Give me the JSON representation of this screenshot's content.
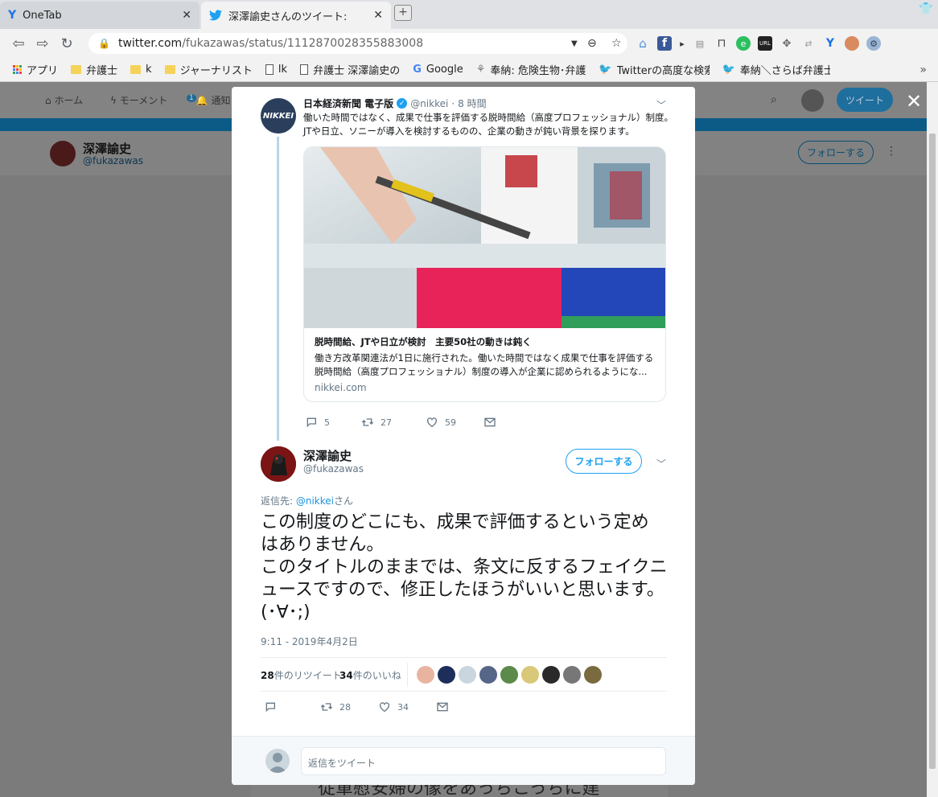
{
  "browser": {
    "tabs": [
      {
        "title": "OneTab",
        "active": false
      },
      {
        "title": "深澤諭史さんのツイート: \"この制",
        "active": true
      }
    ],
    "url_host": "twitter.com",
    "url_path": "/fukazawas/status/1112870028355883008",
    "bookmarks": [
      {
        "label": "アプリ",
        "type": "apps"
      },
      {
        "label": "弁護士",
        "type": "folder"
      },
      {
        "label": "k",
        "type": "folder"
      },
      {
        "label": "ジャーナリスト",
        "type": "folder"
      },
      {
        "label": "lk",
        "type": "doc"
      },
      {
        "label": "弁護士 深澤諭史の",
        "type": "doc"
      },
      {
        "label": "Google",
        "type": "google"
      },
      {
        "label": "奉納: 危険生物･弁護",
        "type": "other"
      },
      {
        "label": "Twitterの高度な検索",
        "type": "twitter"
      },
      {
        "label": "奉納＼さらば弁護士",
        "type": "twitter"
      }
    ],
    "extension_icons": [
      "home-icon",
      "facebook-icon",
      "arrow-icon",
      "box-icon",
      "bookmark-icon",
      "evernote-icon",
      "url-icon",
      "move-icon",
      "link-icon",
      "y-icon",
      "avatar-icon",
      "gear-icon"
    ]
  },
  "background": {
    "nav": {
      "home": "ホーム",
      "moments": "モーメント",
      "notifications": "通知",
      "notif_count": "1"
    },
    "tweet_button": "ツイート",
    "profile_name": "深澤諭史",
    "profile_handle": "@fukazawas",
    "follow_label": "フォローする",
    "bottom_text": "従軍慰安婦の像をあっちこっちに建"
  },
  "quoted_tweet": {
    "name": "日本経済新聞 電子版",
    "handle": "@nikkei",
    "dot": "·",
    "time": "8 時間",
    "avatar_text": "NIKKEI",
    "text": "働いた時間ではなく、成果で仕事を評価する脱時間給（高度プロフェッショナル）制度。JTや日立、ソニーが導入を検討するものの、企業の動きが鈍い背景を探ります。",
    "card": {
      "title": "脱時間給、JTや日立が検討　主要50社の動きは鈍く",
      "description": "働き方改革関連法が1日に施行された。働いた時間ではなく成果で仕事を評価する脱時間給（高度プロフェッショナル）制度の導入が企業に認められるようにな...",
      "domain": "nikkei.com"
    },
    "replies": "5",
    "retweets": "27",
    "likes": "59"
  },
  "main_tweet": {
    "name": "深澤諭史",
    "handle": "@fukazawas",
    "follow_label": "フォローする",
    "reply_prefix": "返信先: ",
    "reply_to": "@nikkei",
    "reply_suffix": "さん",
    "text": "この制度のどこにも、成果で評価するという定め\nはありません。\nこのタイトルのままでは、条文に反するフェイクニ\nュースですので、修正したほうがいいと思います。\n(･∀･;)",
    "timestamp": "9:11 - 2019年4月2日",
    "retweet_count": "28",
    "retweet_label": "件のリツイート",
    "like_count": "34",
    "like_label": "件のいいね",
    "action_retweets": "28",
    "action_likes": "34"
  },
  "reply_box": {
    "placeholder": "返信をツイート"
  },
  "colors": {
    "twitter_blue": "#1da1f2",
    "link_blue": "#1b95e0",
    "gray": "#657786",
    "text": "#14171a"
  }
}
